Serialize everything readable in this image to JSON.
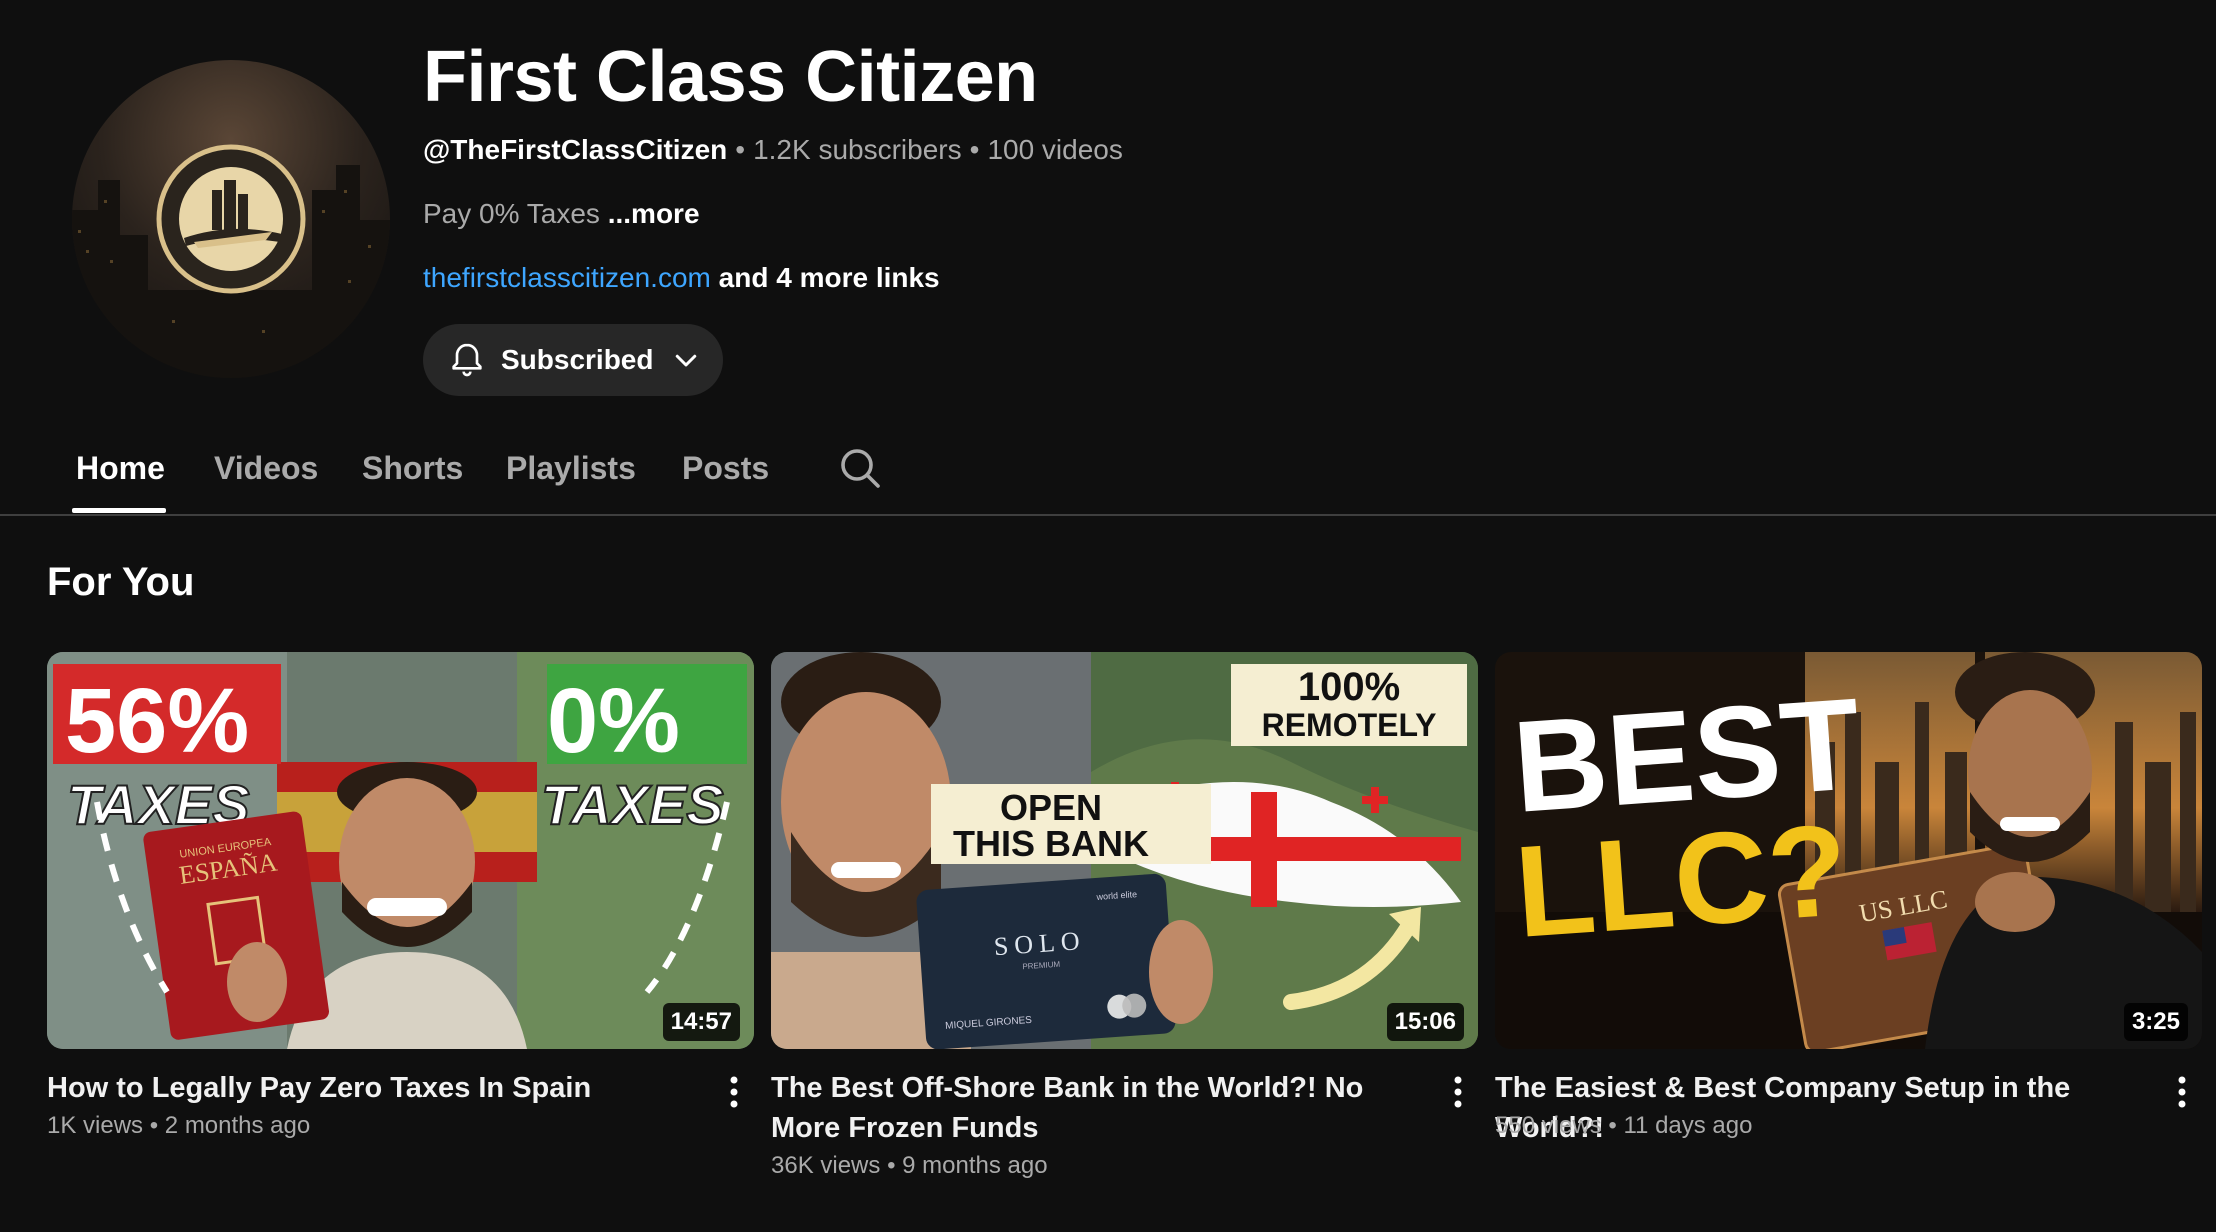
{
  "channel": {
    "name": "First Class Citizen",
    "handle": "@TheFirstClassCitizen",
    "subscribers": "1.2K subscribers",
    "videos": "100 videos",
    "description": "Pay 0% Taxes",
    "description_more": "...more",
    "link": "thefirstclasscitizen.com",
    "more_links": "and 4 more links",
    "subscribe_label": "Subscribed"
  },
  "tabs": [
    {
      "label": "Home",
      "active": true
    },
    {
      "label": "Videos"
    },
    {
      "label": "Shorts"
    },
    {
      "label": "Playlists"
    },
    {
      "label": "Posts"
    }
  ],
  "section": {
    "title": "For You"
  },
  "videos": [
    {
      "title": "How to Legally Pay Zero Taxes In Spain",
      "views": "1K views",
      "age": "2 months ago",
      "duration": "14:57",
      "thumb_text": {
        "left_pct": "56%",
        "left_word": "TAXES",
        "right_pct": "0%",
        "right_word": "TAXES",
        "passport_top": "UNION EUROPEA",
        "passport_country": "ESPAÑA"
      }
    },
    {
      "title": "The Best Off-Shore Bank in the World?! No More Frozen Funds",
      "views": "36K views",
      "age": "9 months ago",
      "duration": "15:06",
      "thumb_text": {
        "top_line1": "100%",
        "top_line2": "REMOTELY",
        "mid_line1": "OPEN",
        "mid_line2": "THIS BANK",
        "card_name": "SOLO",
        "card_sub": "PREMIUM",
        "card_holder": "MIQUEL GIRONES",
        "card_tier": "world elite"
      }
    },
    {
      "title": "The Easiest & Best Company Setup in the World?!",
      "views": "550 views",
      "age": "11 days ago",
      "duration": "3:25",
      "thumb_text": {
        "line1": "BEST",
        "line2": "LLC?",
        "book_label": "US LLC"
      }
    }
  ],
  "colors": {
    "background": "#0f0f0f",
    "link": "#3ea6ff",
    "muted": "#aaaaaa",
    "button": "#272727"
  }
}
